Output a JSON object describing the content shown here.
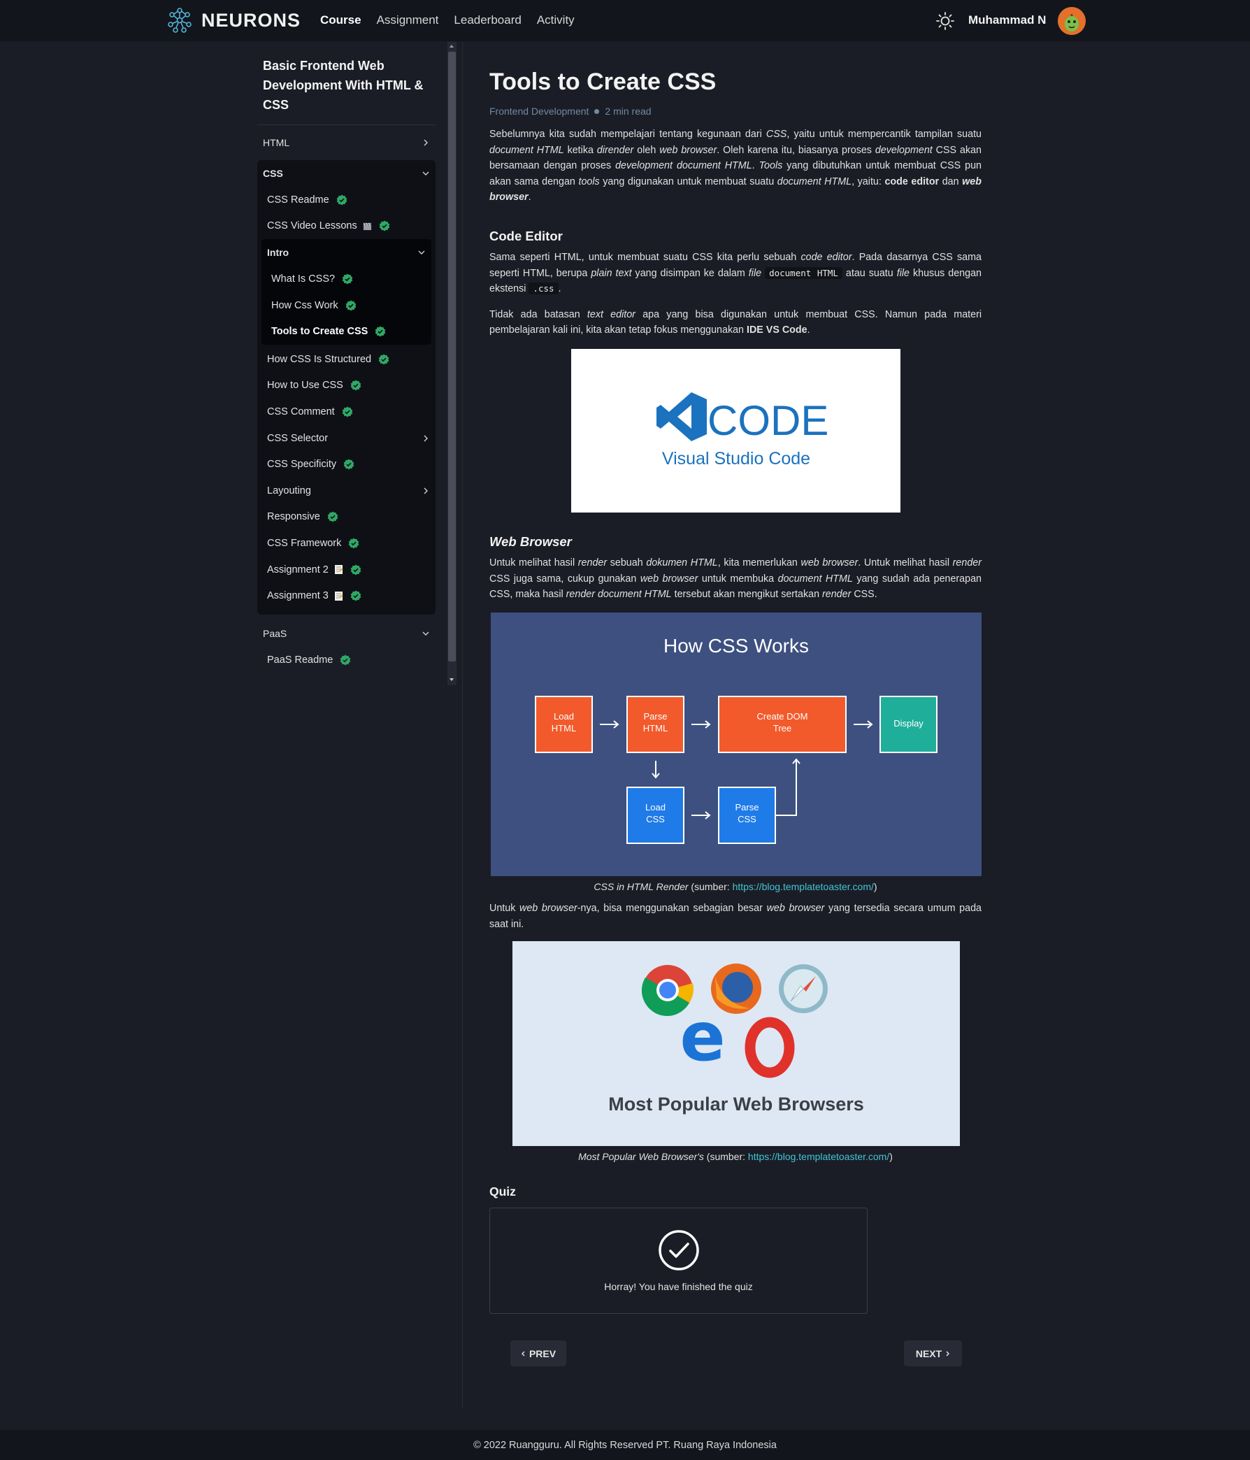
{
  "app": {
    "brand": "NEURONS"
  },
  "nav": {
    "links": [
      "Course",
      "Assignment",
      "Leaderboard",
      "Activity"
    ],
    "active": "Course",
    "user_name": "Muhammad N"
  },
  "sidebar": {
    "course_title": "Basic Frontend Web Development With HTML & CSS",
    "html_label": "HTML",
    "css_label": "CSS",
    "css_items_top": [
      "CSS Readme",
      "CSS Video Lessons"
    ],
    "intro_label": "Intro",
    "intro_items": [
      "What Is CSS?",
      "How Css Work",
      "Tools to Create CSS"
    ],
    "css_items_bottom": [
      "How CSS Is Structured",
      "How to Use CSS",
      "CSS Comment",
      "CSS Selector",
      "CSS Specificity",
      "Layouting",
      "Responsive",
      "CSS Framework",
      "Assignment 2",
      "Assignment 3"
    ],
    "paas_label": "PaaS",
    "paas_items": [
      "PaaS Readme"
    ],
    "colors": {
      "check": "#2fa866"
    }
  },
  "article": {
    "title": "Tools to Create CSS",
    "category": "Frontend Development",
    "read_time": "2 min read",
    "section_code_editor": "Code Editor",
    "section_web_browser": "Web Browser",
    "vscode_image": {
      "word": "CODE",
      "subtitle": "Visual Studio Code"
    },
    "howcss_image": {
      "title": "How CSS Works",
      "load_html": "Load HTML",
      "parse_html": "Parse HTML",
      "create_dom": "Create DOM Tree",
      "display": "Display",
      "load_css": "Load CSS",
      "parse_css": "Parse CSS"
    },
    "caption1_italic": "CSS in HTML Render",
    "caption1_src": " (sumber: ",
    "caption1_link": "https://blog.templatetoaster.com/",
    "caption_close": ")",
    "browsers_image": {
      "title": "Most Popular Web Browsers"
    },
    "caption2_italic": "Most Popular Web Browser's",
    "caption2_src": " (sumber: ",
    "caption2_link": "https://blog.templatetoaster.com/"
  },
  "quiz": {
    "title": "Quiz",
    "message": "Horray! You have finished the quiz"
  },
  "pager": {
    "prev": "PREV",
    "next": "NEXT"
  },
  "footer": {
    "text": "© 2022 Ruangguru. All Rights Reserved PT. Ruang Raya Indonesia"
  }
}
